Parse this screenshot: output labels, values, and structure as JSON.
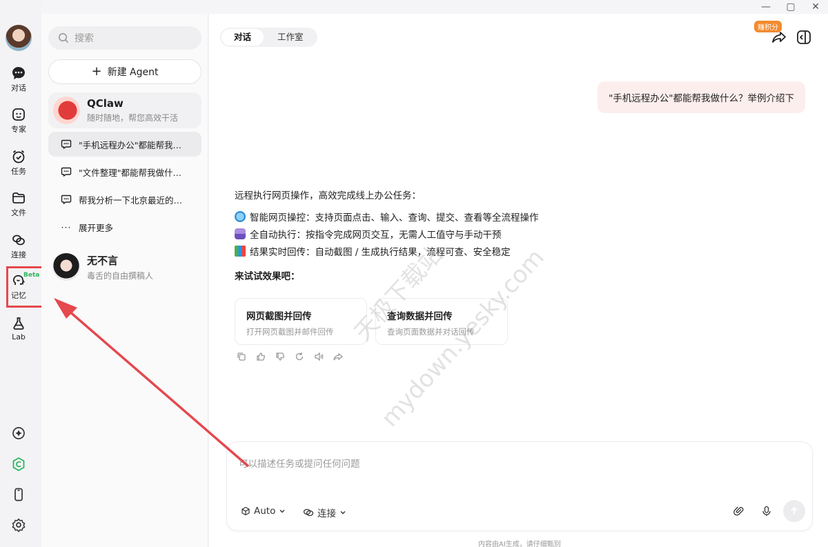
{
  "window": {
    "minimize": "—",
    "maximize": "▢",
    "close": "✕"
  },
  "rail": {
    "items": [
      {
        "label": "对话",
        "icon": "chat-icon"
      },
      {
        "label": "专家",
        "icon": "expert-icon"
      },
      {
        "label": "任务",
        "icon": "alarm-icon"
      },
      {
        "label": "文件",
        "icon": "folder-icon"
      },
      {
        "label": "连接",
        "icon": "link-icon"
      },
      {
        "label": "记忆",
        "icon": "memory-icon",
        "badge": "Beta"
      },
      {
        "label": "Lab",
        "icon": "flask-icon"
      }
    ],
    "accent": "#2db55d",
    "highlight_color": "#e5484d"
  },
  "sidebar": {
    "search_placeholder": "搜索",
    "new_agent_label": "新建 Agent",
    "agents": [
      {
        "name": "QClaw",
        "subtitle": "随时随地，帮您高效干活"
      },
      {
        "name": "无不言",
        "subtitle": "毒舌的自由撰稿人"
      }
    ],
    "conversations": [
      {
        "title": "\"手机远程办公\"都能帮我做什么？举例介绍下",
        "active": true
      },
      {
        "title": "\"文件整理\"都能帮我做什么？举例介绍下",
        "active": false
      },
      {
        "title": "帮我分析一下北京最近的天气",
        "active": false
      }
    ],
    "more_label": "展开更多"
  },
  "main": {
    "tabs": [
      {
        "label": "对话",
        "active": true
      },
      {
        "label": "工作室",
        "active": false
      }
    ],
    "earn_badge": "赚积分",
    "user_message": "\"手机远程办公\"都能帮我做什么？举例介绍下",
    "reply": {
      "intro": "远程执行网页操作，高效完成线上办公任务：",
      "points": [
        {
          "emoji": "globe",
          "text": "智能网页操控：支持页面点击、输入、查询、提交、查看等全流程操作"
        },
        {
          "emoji": "robot",
          "text": "全自动执行：按指令完成网页交互，无需人工值守与手动干预"
        },
        {
          "emoji": "chart",
          "text": "结果实时回传：自动截图 / 生成执行结果，流程可查、安全稳定"
        }
      ],
      "try_label": "来试试效果吧：",
      "cards": [
        {
          "title": "网页截图并回传",
          "subtitle": "打开网页截图并邮件回传"
        },
        {
          "title": "查询数据并回传",
          "subtitle": "查询页面数据并对话回传"
        }
      ]
    },
    "composer": {
      "placeholder": "可以描述任务或提问任何问题",
      "model_label": "Auto",
      "connect_label": "连接"
    },
    "footnote": "内容由AI生成，请仔细甄别"
  },
  "watermark": {
    "line1": "天极下载站",
    "line2": "mydown.yesky.com"
  }
}
